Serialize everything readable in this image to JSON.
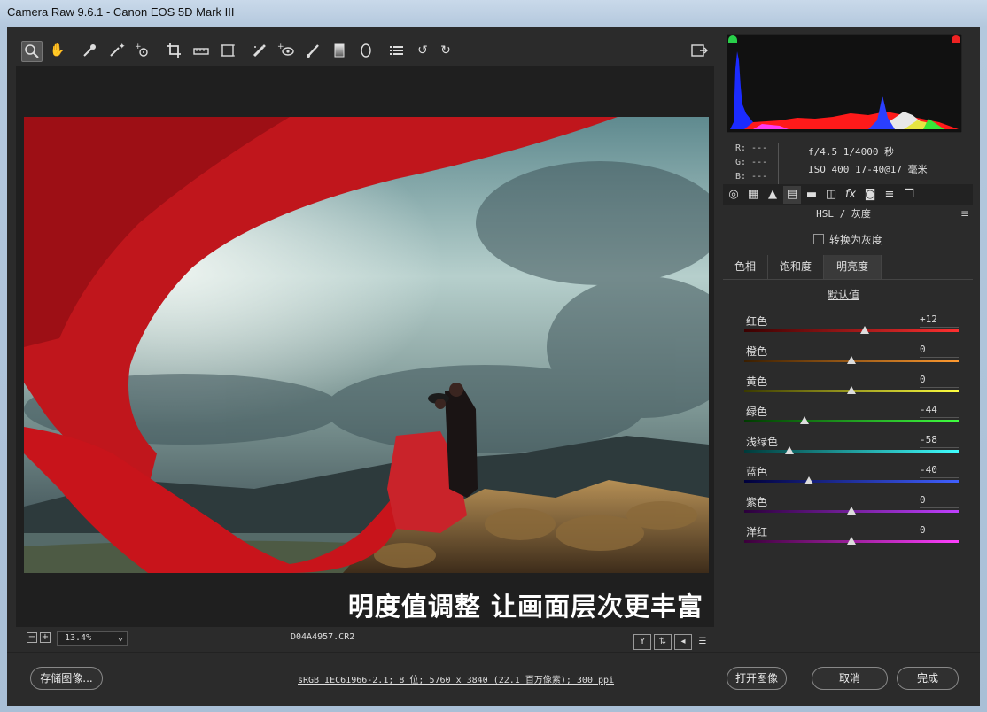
{
  "window": {
    "title": "Camera Raw 9.6.1 -  Canon EOS 5D Mark III"
  },
  "toolbar": {
    "tools": [
      "zoom-icon",
      "hand-icon",
      "white-balance-icon",
      "color-sampler-icon",
      "target-adjust-icon",
      "crop-icon",
      "straighten-icon",
      "transform-icon",
      "spot-removal-icon",
      "red-eye-icon",
      "adjustment-brush-icon",
      "graduated-filter-icon",
      "radial-filter-icon",
      "preferences-icon",
      "rotate-left-icon",
      "rotate-right-icon"
    ]
  },
  "photo": {
    "caption": "明度值调整 让画面层次更丰富"
  },
  "status": {
    "zoom": "13.4%",
    "filename": "D04A4957.CR2"
  },
  "info": {
    "r": "R:  ---",
    "g": "G:  ---",
    "b": "B:  ---",
    "exif_line1": "f/4.5  1/4000 秒",
    "exif_line2": "ISO 400  17-40@17 毫米"
  },
  "panel": {
    "title": "HSL / 灰度",
    "grayscale_label": "转换为灰度",
    "subtabs": [
      "色相",
      "饱和度",
      "明亮度"
    ],
    "active_subtab": "明亮度",
    "default_label": "默认值",
    "sliders": [
      {
        "label": "红色",
        "value": "+12",
        "pos": 0.56,
        "from": "#3a0000",
        "to": "#ff3030"
      },
      {
        "label": "橙色",
        "value": "0",
        "pos": 0.5,
        "from": "#3a1e00",
        "to": "#ff9a30"
      },
      {
        "label": "黄色",
        "value": "0",
        "pos": 0.5,
        "from": "#3a3a00",
        "to": "#ffff40"
      },
      {
        "label": "绿色",
        "value": "-44",
        "pos": 0.28,
        "from": "#003a00",
        "to": "#40ff40"
      },
      {
        "label": "浅绿色",
        "value": "-58",
        "pos": 0.21,
        "from": "#003a3a",
        "to": "#40ffff"
      },
      {
        "label": "蓝色",
        "value": "-40",
        "pos": 0.3,
        "from": "#00003a",
        "to": "#4060ff"
      },
      {
        "label": "紫色",
        "value": "0",
        "pos": 0.5,
        "from": "#2a003a",
        "to": "#c040ff"
      },
      {
        "label": "洋红",
        "value": "0",
        "pos": 0.5,
        "from": "#3a003a",
        "to": "#ff40ff"
      }
    ]
  },
  "bottom": {
    "save_label": "存储图像...",
    "workflow": "sRGB IEC61966-2.1; 8 位; 5760 x 3840 (22.1 百万像素); 300 ppi",
    "open_label": "打开图像",
    "cancel_label": "取消",
    "done_label": "完成"
  }
}
